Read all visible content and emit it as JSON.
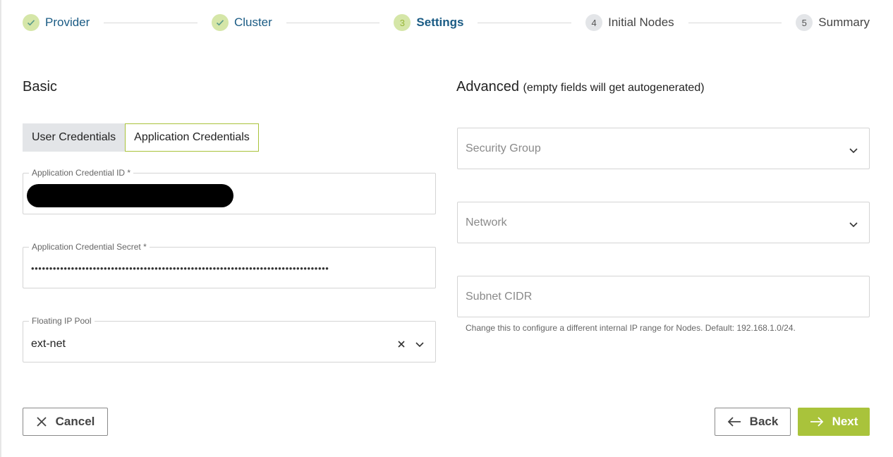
{
  "stepper": {
    "steps": [
      {
        "number": "",
        "label": "Provider",
        "state": "done"
      },
      {
        "number": "",
        "label": "Cluster",
        "state": "done"
      },
      {
        "number": "3",
        "label": "Settings",
        "state": "active"
      },
      {
        "number": "4",
        "label": "Initial Nodes",
        "state": "todo"
      },
      {
        "number": "5",
        "label": "Summary",
        "state": "todo"
      }
    ]
  },
  "basic": {
    "title": "Basic",
    "tabs": [
      {
        "label": "User Credentials",
        "active": false
      },
      {
        "label": "Application Credentials",
        "active": true
      }
    ],
    "app_cred_id": {
      "label": "Application Credential ID *",
      "value": ""
    },
    "app_cred_secret": {
      "label": "Application Credential Secret *",
      "value": "••••••••••••••••••••••••••••••••••••••••••••••••••••••••••••••••••••••••••••••••••"
    },
    "floating_ip_pool": {
      "label": "Floating IP Pool",
      "value": "ext-net"
    }
  },
  "advanced": {
    "title": "Advanced",
    "subtitle": "(empty fields will get autogenerated)",
    "security_group": {
      "placeholder": "Security Group"
    },
    "network": {
      "placeholder": "Network"
    },
    "subnet_cidr": {
      "placeholder": "Subnet CIDR",
      "hint": "Change this to configure a different internal IP range for Nodes. Default: 192.168.1.0/24."
    }
  },
  "actions": {
    "cancel_label": "Cancel",
    "back_label": "Back",
    "next_label": "Next"
  },
  "colors": {
    "accent": "#a9c33b",
    "step_done_bg": "#d5e6a8",
    "step_label": "#1a5b84"
  },
  "icons": {
    "check": "check-icon",
    "chevron": "chevron-down-icon",
    "clear": "close-icon",
    "back": "arrow-left-icon",
    "next": "arrow-right-icon"
  }
}
